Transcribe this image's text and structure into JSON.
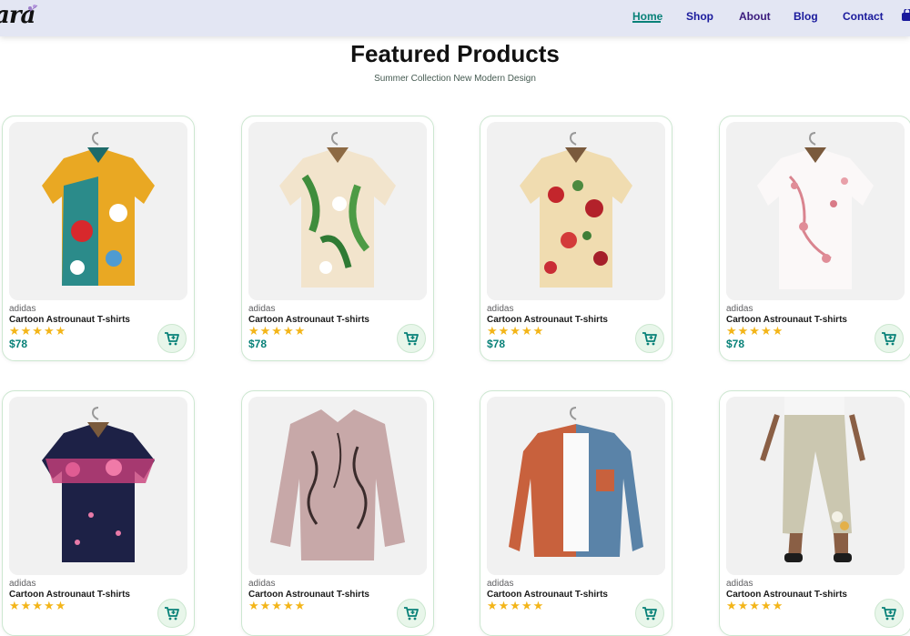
{
  "header": {
    "logo_text": "ara",
    "nav": [
      "Home",
      "Shop",
      "About",
      "Blog",
      "Contact"
    ],
    "active_nav": "Home"
  },
  "section": {
    "title": "Featured Products",
    "subtitle": "Summer Collection New Modern Design"
  },
  "products": [
    {
      "brand": "adidas",
      "name": "Cartoon Astrounaut T-shirts",
      "price": "$78",
      "rating": 5,
      "icon": "colorful-shirt-icon"
    },
    {
      "brand": "adidas",
      "name": "Cartoon Astrounaut T-shirts",
      "price": "$78",
      "rating": 5,
      "icon": "floral-shirt-icon"
    },
    {
      "brand": "adidas",
      "name": "Cartoon Astrounaut T-shirts",
      "price": "$78",
      "rating": 5,
      "icon": "rose-shirt-icon"
    },
    {
      "brand": "adidas",
      "name": "Cartoon Astrounaut T-shirts",
      "price": "$78",
      "rating": 5,
      "icon": "pink-blossom-shirt-icon"
    },
    {
      "brand": "adidas",
      "name": "Cartoon Astrounaut T-shirts",
      "price": "",
      "rating": 5,
      "icon": "navy-floral-shirt-icon"
    },
    {
      "brand": "adidas",
      "name": "Cartoon Astrounaut T-shirts",
      "price": "",
      "rating": 5,
      "icon": "patterned-blouse-icon"
    },
    {
      "brand": "adidas",
      "name": "Cartoon Astrounaut T-shirts",
      "price": "",
      "rating": 5,
      "icon": "two-tone-jacket-icon"
    },
    {
      "brand": "adidas",
      "name": "Cartoon Astrounaut T-shirts",
      "price": "",
      "rating": 5,
      "icon": "linen-pants-icon"
    }
  ],
  "colors": {
    "accent": "#088178",
    "nav": "#1a1a9c",
    "star": "#f3b519",
    "header_bg": "#e3e6f3"
  }
}
